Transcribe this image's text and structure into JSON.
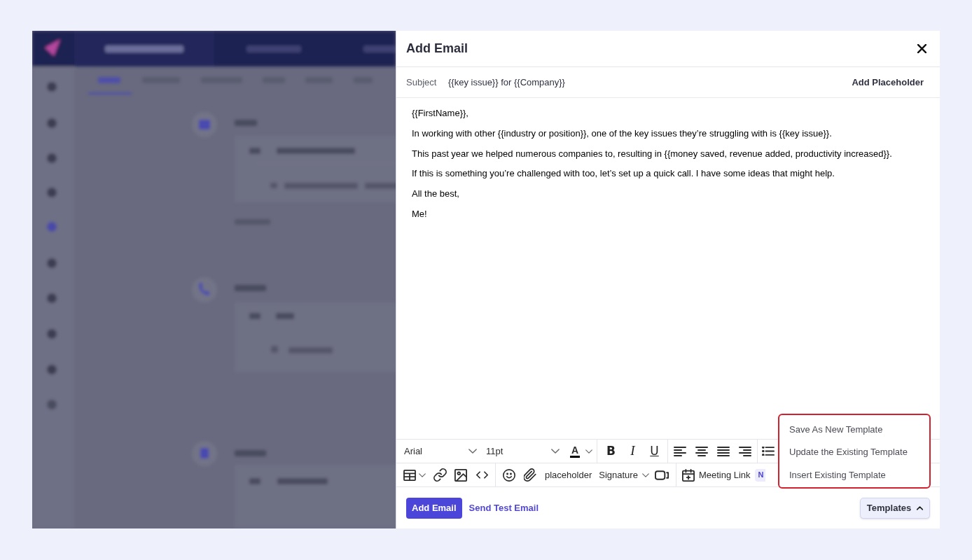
{
  "dialog": {
    "title": "Add Email"
  },
  "subject": {
    "label": "Subject",
    "value": "{{key issue}} for {{Company}}",
    "action": "Add Placeholder"
  },
  "body": {
    "lines": [
      "{{FirstName}},",
      "In working with other {{industry or position}}, one of the key issues they’re struggling with is {{key issue}}.",
      "This past year we helped numerous companies to, resulting in {{money saved, revenue added, productivity increased}}.",
      "If this is something you’re challenged with too, let’s set up a quick call. I have some ideas that might help.",
      "All the best,",
      "Me!"
    ]
  },
  "toolbar": {
    "font": "Arial",
    "size": "11pt",
    "text_color": "A",
    "format_buttons": [
      {
        "kind": "bold",
        "label": "B"
      },
      {
        "kind": "italic",
        "label": "I"
      },
      {
        "kind": "underline",
        "label": "U"
      }
    ],
    "placeholder": "placeholder",
    "signature": "Signature",
    "meeting_link": {
      "label": "Meeting Link",
      "badge": "N"
    }
  },
  "footer": {
    "primary_button": "Add Email",
    "test_link": "Send Test Email",
    "templates": {
      "label": "Templates",
      "expanded": true,
      "menu": [
        "Save As New Template",
        "Update the Existing Template",
        "Insert Existing Template"
      ]
    }
  }
}
